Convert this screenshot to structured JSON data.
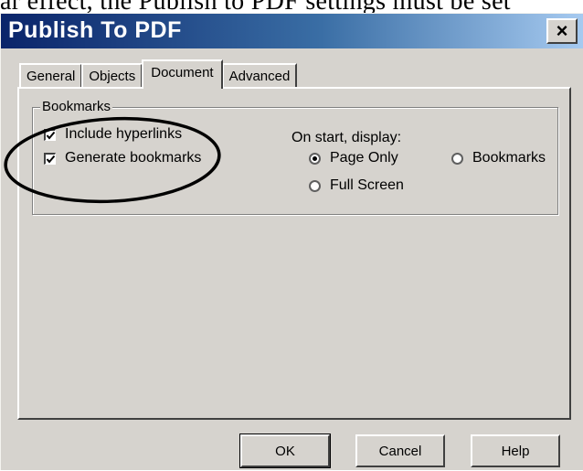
{
  "document_snippet": "ar effect, the Publish to PDF settings must be set",
  "dialog": {
    "title": "Publish To PDF",
    "close_label": "×"
  },
  "tabs": [
    {
      "label": "General",
      "active": false
    },
    {
      "label": "Objects",
      "active": false
    },
    {
      "label": "Document",
      "active": true
    },
    {
      "label": "Advanced",
      "active": false
    }
  ],
  "bookmarks_group": {
    "label": "Bookmarks",
    "include_hyperlinks": {
      "label": "Include hyperlinks",
      "checked": true
    },
    "generate_bookmarks": {
      "label": "Generate bookmarks",
      "checked": true
    }
  },
  "start_display": {
    "label": "On start, display:",
    "options": [
      {
        "label": "Page Only",
        "selected": true
      },
      {
        "label": "Bookmarks",
        "selected": false
      },
      {
        "label": "Full Screen",
        "selected": false
      }
    ]
  },
  "buttons": {
    "ok": "OK",
    "cancel": "Cancel",
    "help": "Help"
  },
  "colors": {
    "title_gradient_start": "#0a246a",
    "title_gradient_end": "#a6caf0",
    "dialog_face": "#d6d3ce",
    "annotation_ink": "#000000"
  }
}
